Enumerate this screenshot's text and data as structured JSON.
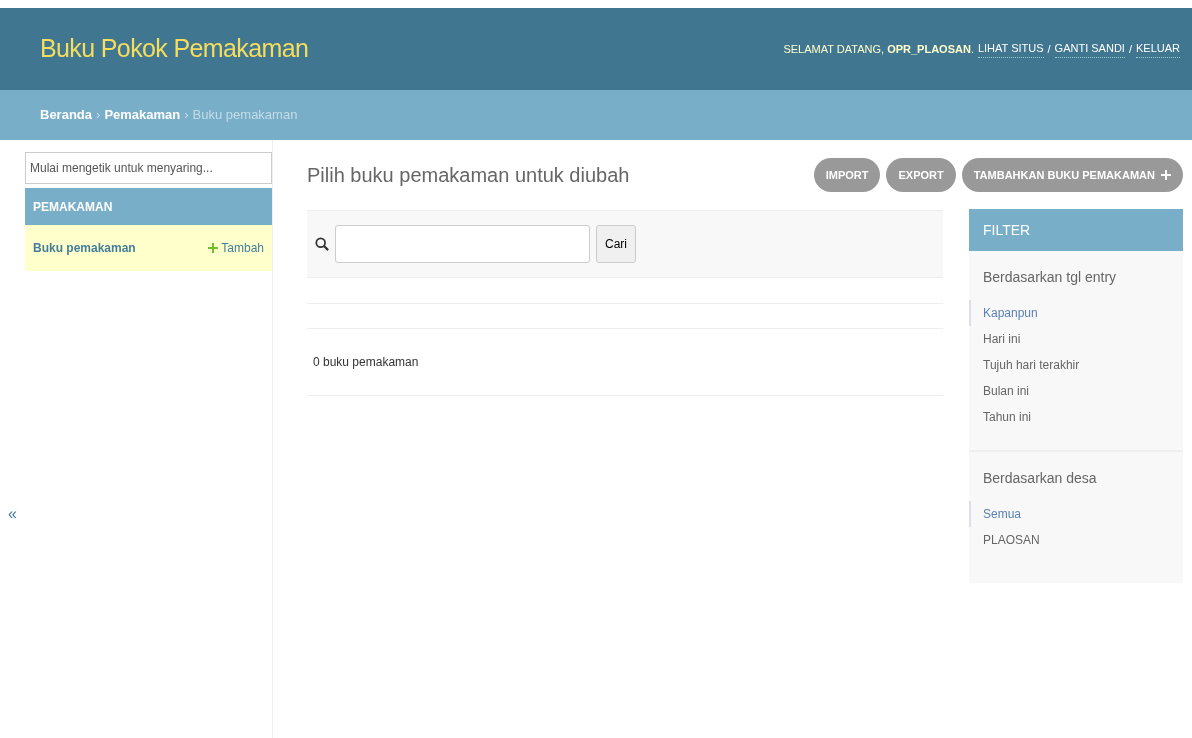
{
  "header": {
    "title": "Buku Pokok Pemakaman",
    "welcome": "SELAMAT DATANG, **OPR_PLAOSAN**.",
    "links": [
      "LIHAT SITUS",
      "GANTI SANDI",
      "KELUAR"
    ],
    "link_separator": "/"
  },
  "breadcrumbs": {
    "separator": "›",
    "items": [
      {
        "label": "Beranda",
        "current": false
      },
      {
        "label": "Pemakaman",
        "current": false
      },
      {
        "label": "Buku pemakaman",
        "current": true
      }
    ]
  },
  "sidebar": {
    "filter_placeholder": "Mulai mengetik untuk menyaring...",
    "section": "PEMAKAMAN",
    "items": [
      {
        "label": "Buku pemakaman",
        "add_label": "Tambah",
        "selected": true
      }
    ],
    "collapse": "«"
  },
  "content": {
    "title": "Pilih buku pemakaman untuk diubah",
    "buttons": [
      {
        "label": "IMPORT",
        "kind": "plain"
      },
      {
        "label": "EXPORT",
        "kind": "plain"
      },
      {
        "label": "TAMBAHKAN BUKU PEMAKAMAN",
        "kind": "add"
      }
    ],
    "search_button": "Cari",
    "result_count": "0 buku pemakaman"
  },
  "filter": {
    "title": "FILTER",
    "groups": [
      {
        "title": "Berdasarkan tgl entry",
        "options": [
          {
            "label": "Kapanpun",
            "selected": true
          },
          {
            "label": "Hari ini",
            "selected": false
          },
          {
            "label": "Tujuh hari terakhir",
            "selected": false
          },
          {
            "label": "Bulan ini",
            "selected": false
          },
          {
            "label": "Tahun ini",
            "selected": false
          }
        ]
      },
      {
        "title": "Berdasarkan desa",
        "options": [
          {
            "label": "Semua",
            "selected": true
          },
          {
            "label": "PLAOSAN",
            "selected": false
          }
        ]
      }
    ]
  }
}
